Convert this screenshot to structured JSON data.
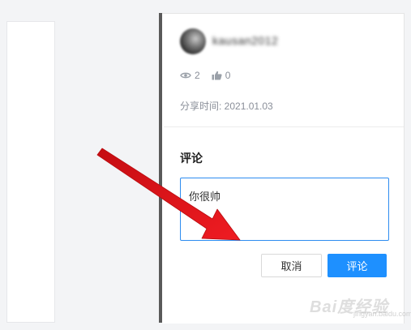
{
  "profile": {
    "username": "kausan2012",
    "views": "2",
    "likes": "0",
    "share_time": "分享时间: 2021.01.03"
  },
  "comment": {
    "label": "评论",
    "input_value": "你很帅",
    "cancel_label": "取消",
    "submit_label": "评论"
  },
  "icons": {
    "views": "eye-icon",
    "likes": "thumbs-up-icon"
  },
  "annotation": {
    "arrow_color": "#e8141b"
  },
  "watermark": {
    "brand": "Bai度经验",
    "url": "jingyan.baidu.com"
  },
  "colors": {
    "accent": "#1e90ff",
    "focus_border": "#2d8cf0"
  }
}
